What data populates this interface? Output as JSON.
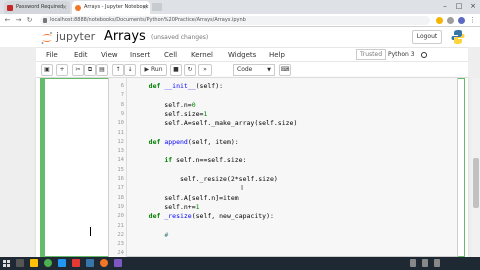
{
  "browser": {
    "tabs": [
      {
        "label": "Password Required"
      },
      {
        "label": "Arrays - Jupyter Notebook"
      }
    ],
    "url": "localhost:8888/notebooks/Documents/Python%20Practice/Arrays/Arrays.ipynb"
  },
  "jupyter": {
    "brand": "jupyter",
    "notebook_name": "Arrays",
    "status": "(unsaved changes)",
    "logout_label": "Logout"
  },
  "menu": {
    "items": [
      "File",
      "Edit",
      "View",
      "Insert",
      "Cell",
      "Kernel",
      "Widgets",
      "Help"
    ],
    "trusted": "Trusted",
    "kernel": "Python 3"
  },
  "toolbar": {
    "run_label": "Run",
    "cell_type": "Code"
  },
  "code": {
    "lines": [
      {
        "num": "6",
        "text": "    def __init__(self):"
      },
      {
        "num": "7",
        "text": ""
      },
      {
        "num": "8",
        "text": "        self.n=0"
      },
      {
        "num": "9",
        "text": "        self.size=1"
      },
      {
        "num": "10",
        "text": "        self.A=self._make_array(self.size)"
      },
      {
        "num": "11",
        "text": ""
      },
      {
        "num": "12",
        "text": "    def append(self, item):"
      },
      {
        "num": "13",
        "text": ""
      },
      {
        "num": "14",
        "text": "        if self.n==self.size:"
      },
      {
        "num": "15",
        "text": ""
      },
      {
        "num": "16",
        "text": "            self._resize(2*self.size)"
      },
      {
        "num": "17",
        "text": ""
      },
      {
        "num": "18",
        "text": "        self.A[self.n]=item"
      },
      {
        "num": "19",
        "text": "        self.n+=1"
      },
      {
        "num": "20",
        "text": "    def _resize(self, new_capacity):"
      },
      {
        "num": "21",
        "text": ""
      },
      {
        "num": "22",
        "text": "        #"
      },
      {
        "num": "23",
        "text": ""
      },
      {
        "num": "24",
        "text": ""
      }
    ]
  },
  "colors": {
    "selected_cell_border": "#66bb6a",
    "keyword": "#008000",
    "function_name": "#0000ff",
    "number": "#008800",
    "comment": "#408080",
    "taskbar": "#1f2933"
  }
}
